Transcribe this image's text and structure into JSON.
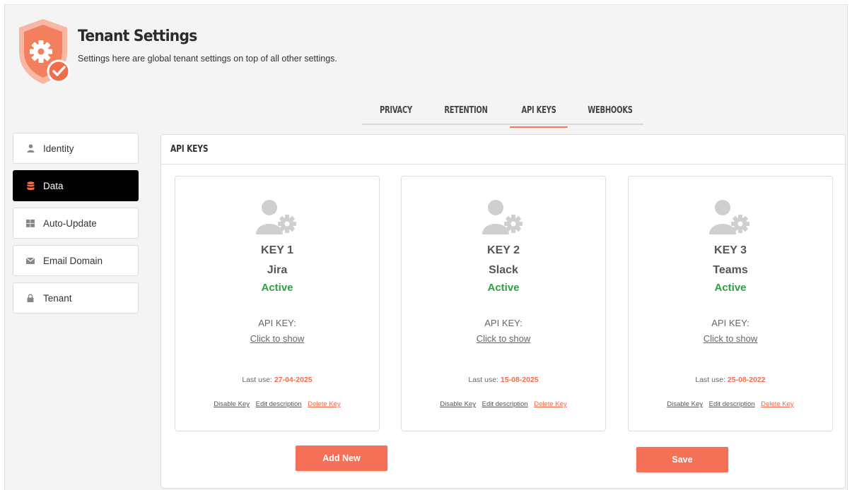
{
  "header": {
    "title": "Tenant Settings",
    "subtitle": "Settings here are global tenant settings on top of all other settings."
  },
  "tabs": [
    {
      "label": "PRIVACY",
      "active": false
    },
    {
      "label": "RETENTION",
      "active": false
    },
    {
      "label": "API KEYS",
      "active": true
    },
    {
      "label": "WEBHOOKS",
      "active": false
    }
  ],
  "sidebar": {
    "items": [
      {
        "label": "Identity",
        "icon": "user-icon",
        "active": false
      },
      {
        "label": "Data",
        "icon": "database-icon",
        "active": true
      },
      {
        "label": "Auto-Update",
        "icon": "windows-icon",
        "active": false
      },
      {
        "label": "Email Domain",
        "icon": "envelope-icon",
        "active": false
      },
      {
        "label": "Tenant",
        "icon": "lock-icon",
        "active": false
      }
    ]
  },
  "panel": {
    "title": "API KEYS",
    "keys": [
      {
        "number": "KEY 1",
        "name": "Jira",
        "status": "Active",
        "api_label": "API KEY:",
        "show_label": "Click to show",
        "last_use_label": "Last use:",
        "last_use": "27-04-2025",
        "disable": "Disable Key",
        "edit": "Edit description",
        "delete": "Delete Key"
      },
      {
        "number": "KEY 2",
        "name": "Slack",
        "status": "Active",
        "api_label": "API KEY:",
        "show_label": "Click to show",
        "last_use_label": "Last use:",
        "last_use": "15-08-2025",
        "disable": "Disable Key",
        "edit": "Edit description",
        "delete": "Delete Key"
      },
      {
        "number": "KEY 3",
        "name": "Teams",
        "status": "Active",
        "api_label": "API KEY:",
        "show_label": "Click to show",
        "last_use_label": "Last use:",
        "last_use": "25-08-2022",
        "disable": "Disable Key",
        "edit": "Edit description",
        "delete": "Delete Key"
      }
    ],
    "add_new_label": "Add New",
    "save_label": "Save"
  },
  "colors": {
    "accent": "#f47157",
    "active_status": "#2ea043",
    "sidebar_active": "#000000"
  }
}
